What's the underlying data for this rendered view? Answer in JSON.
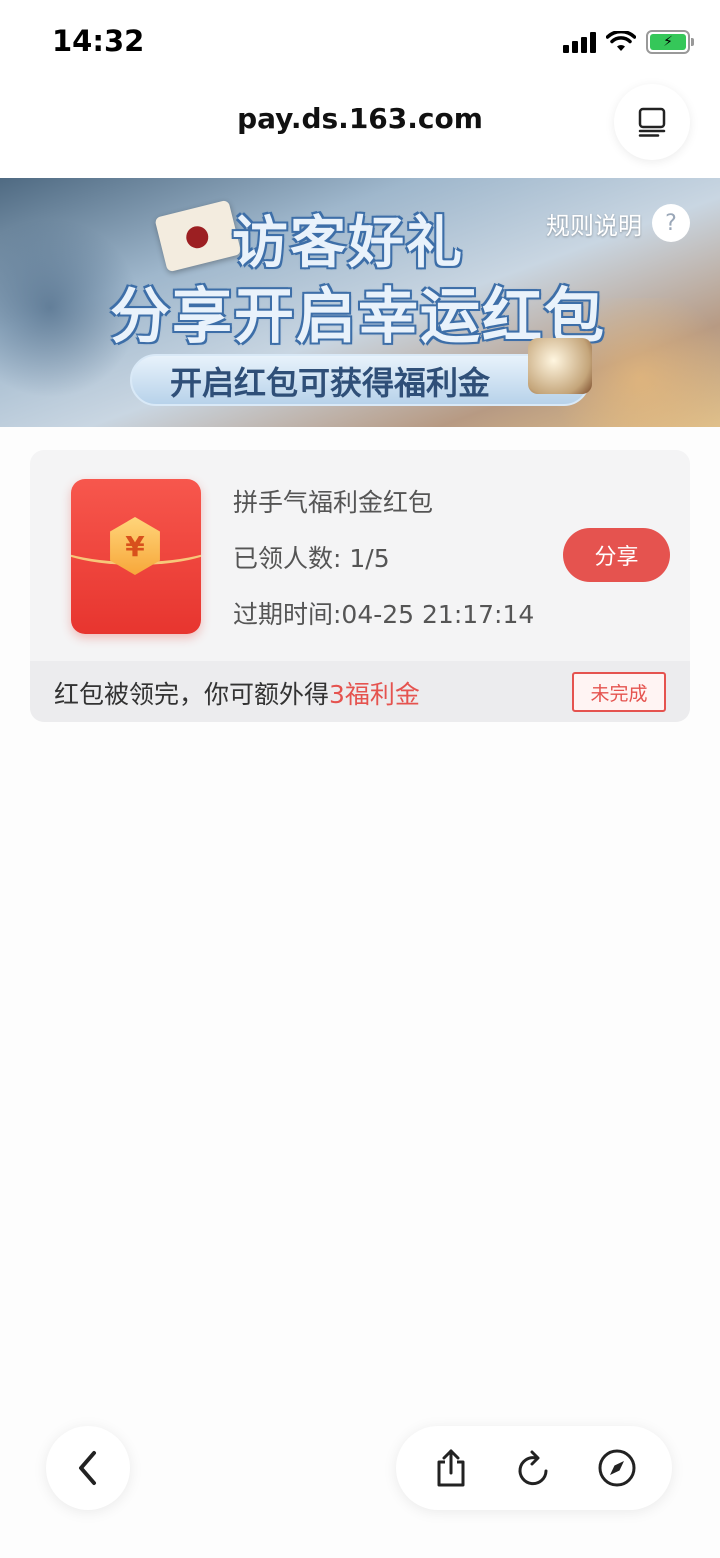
{
  "status_bar": {
    "time": "14:32"
  },
  "browser": {
    "url": "pay.ds.163.com"
  },
  "banner": {
    "title_line1": "访客好礼",
    "title_line2": "分享开启幸运红包",
    "subtitle": "开启红包可获得福利金",
    "rules_label": "规则说明",
    "rules_icon": "?"
  },
  "card": {
    "title": "拼手气福利金红包",
    "claimed": "已领人数: 1/5",
    "expire": "过期时间:04-25 21:17:14",
    "share_label": "分享",
    "currency_symbol": "¥",
    "footer_prefix": "红包被领完，你可额外得",
    "footer_highlight": "3福利金",
    "status_tag": "未完成"
  },
  "colors": {
    "accent_red": "#e5534f",
    "card_bg": "#f4f4f5"
  },
  "icons": {
    "tabs": "tabs-icon",
    "back": "chevron-left-icon",
    "share": "share-icon",
    "reload": "reload-icon",
    "compass": "compass-icon"
  }
}
